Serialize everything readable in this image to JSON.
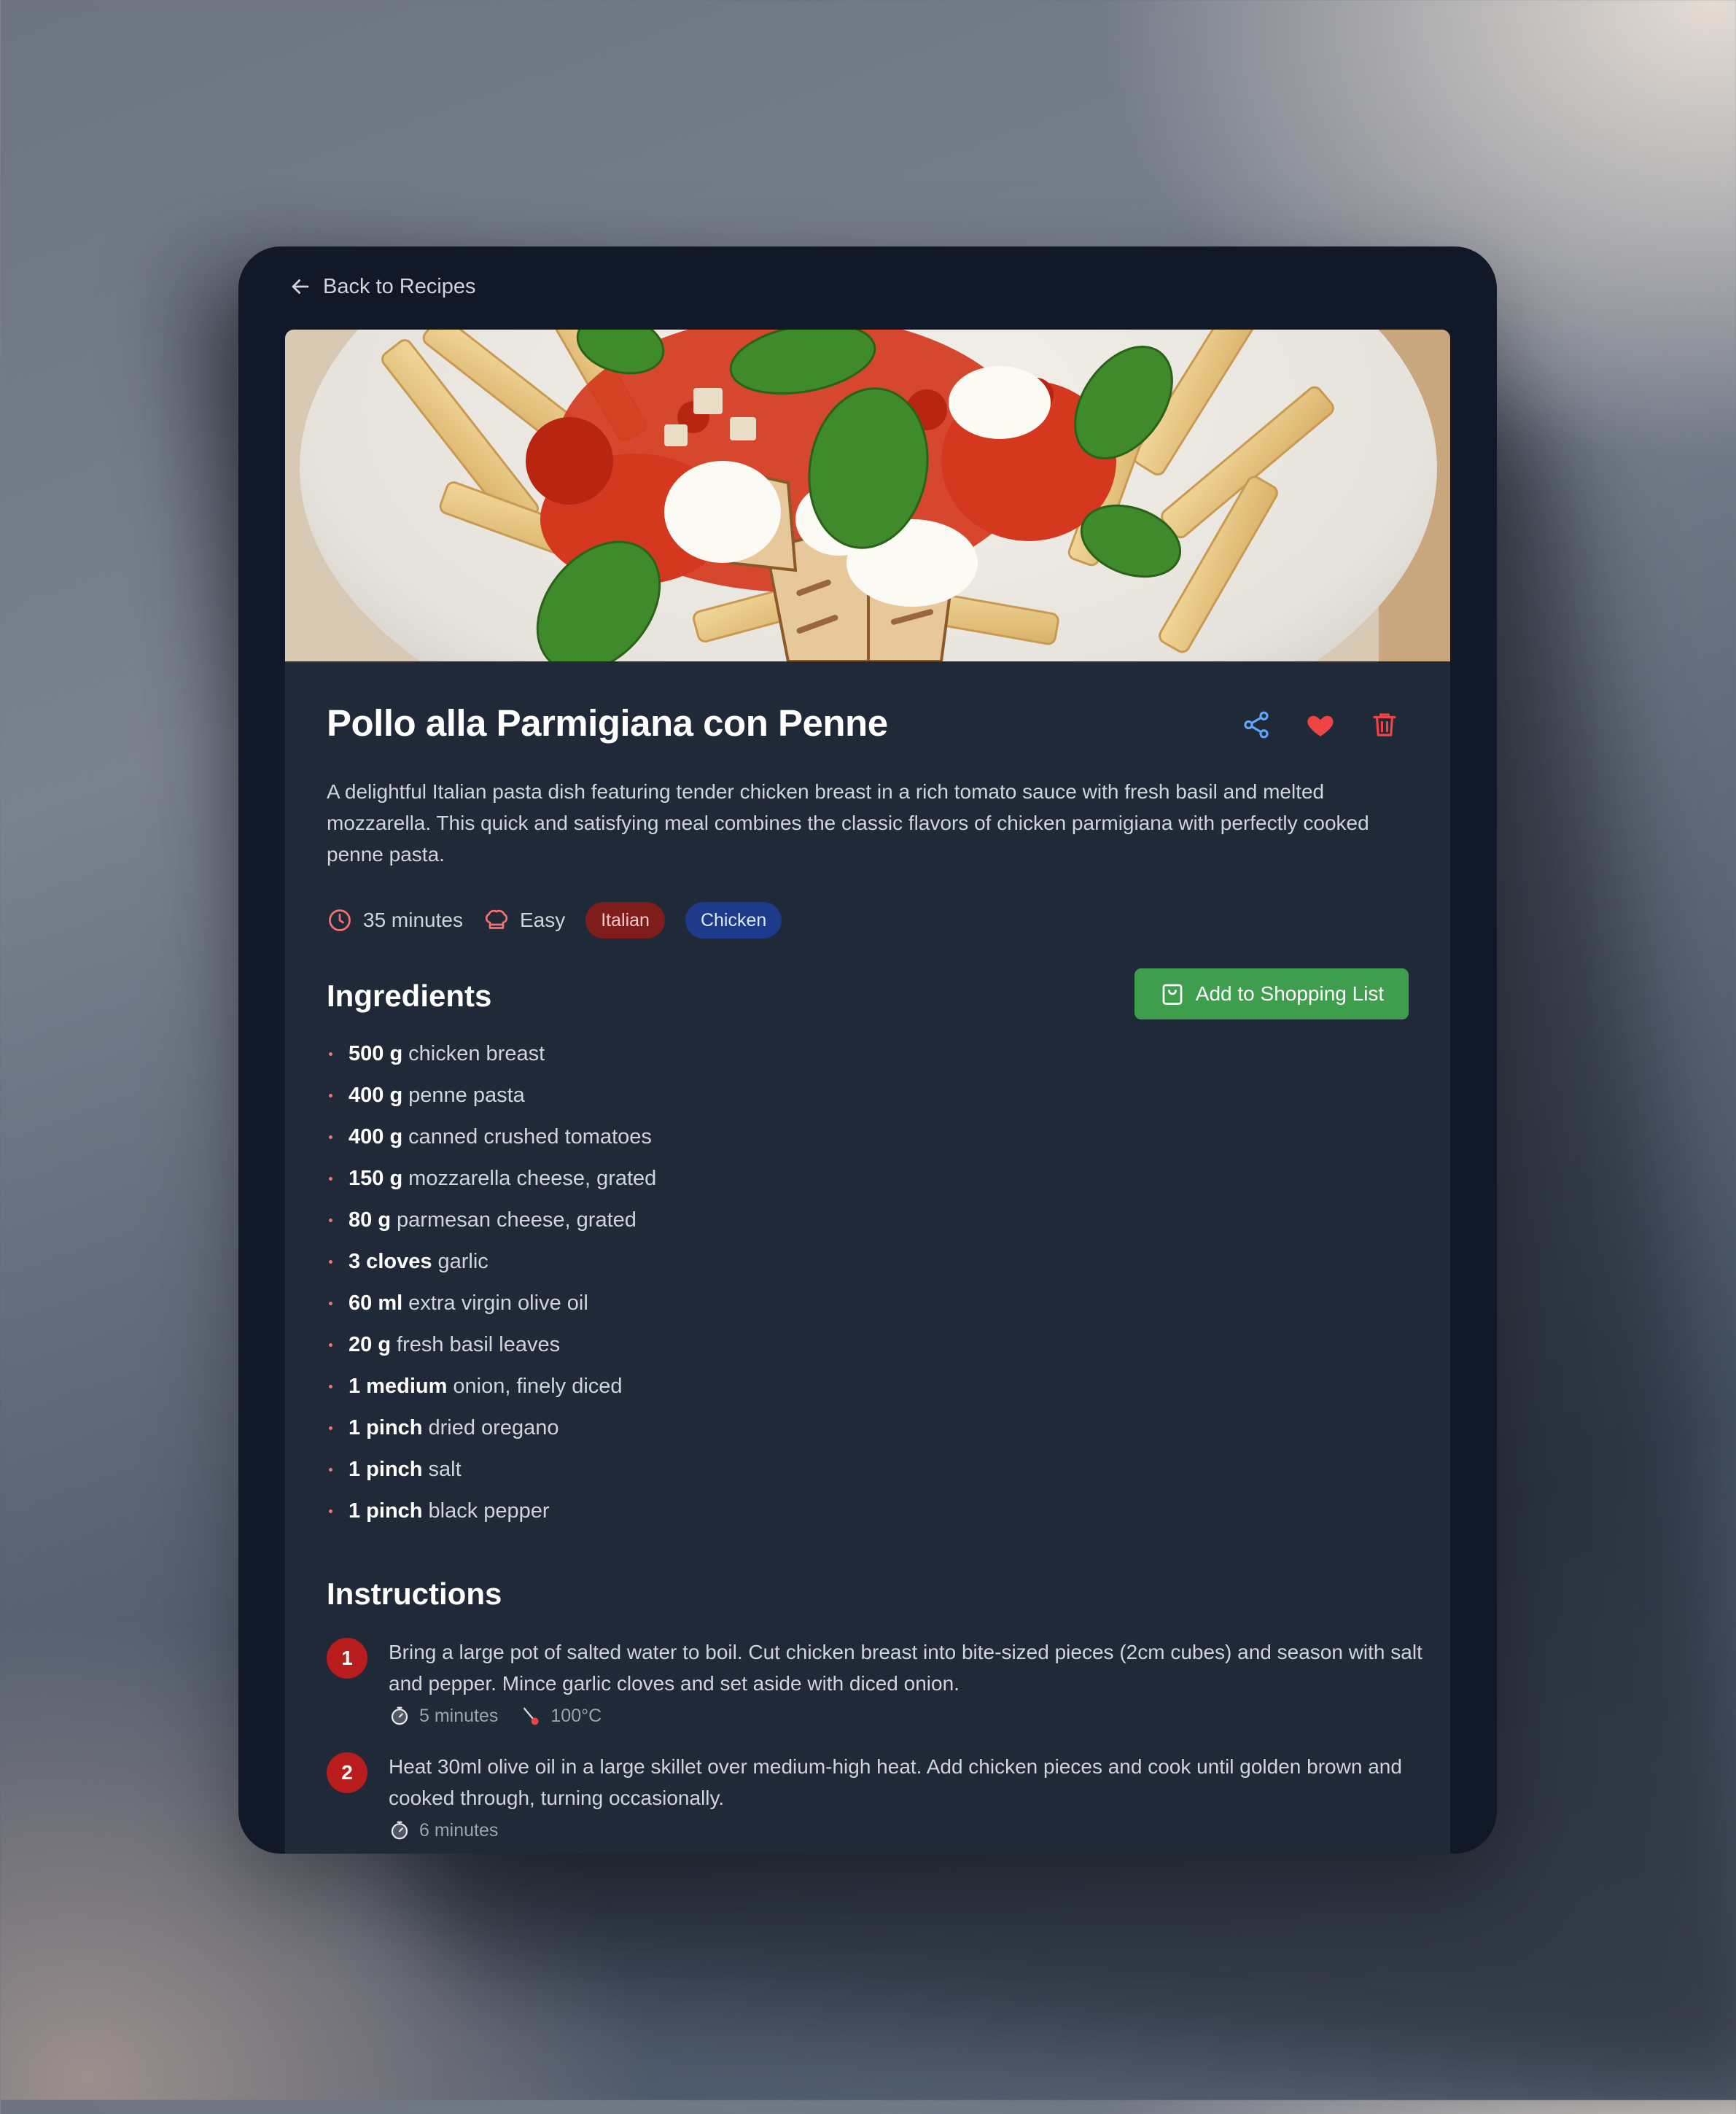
{
  "nav": {
    "back_label": "Back to Recipes"
  },
  "recipe": {
    "title": "Pollo alla Parmigiana con Penne",
    "description": "A delightful Italian pasta dish featuring tender chicken breast in a rich tomato sauce with fresh basil and melted mozzarella. This quick and satisfying meal combines the classic flavors of chicken parmigiana with perfectly cooked penne pasta.",
    "time": "35 minutes",
    "difficulty": "Easy",
    "tags": [
      "Italian",
      "Chicken"
    ]
  },
  "actions": {
    "icons": [
      "share-icon",
      "heart-icon",
      "trash-icon"
    ]
  },
  "ingredients": {
    "heading": "Ingredients",
    "shopping_button": "Add to Shopping List",
    "items": [
      {
        "qty": "500 g",
        "name": "chicken breast"
      },
      {
        "qty": "400 g",
        "name": "penne pasta"
      },
      {
        "qty": "400 g",
        "name": "canned crushed tomatoes"
      },
      {
        "qty": "150 g",
        "name": "mozzarella cheese, grated"
      },
      {
        "qty": "80 g",
        "name": "parmesan cheese, grated"
      },
      {
        "qty": "3 cloves",
        "name": "garlic"
      },
      {
        "qty": "60 ml",
        "name": "extra virgin olive oil"
      },
      {
        "qty": "20 g",
        "name": "fresh basil leaves"
      },
      {
        "qty": "1 medium",
        "name": "onion, finely diced"
      },
      {
        "qty": "1 pinch",
        "name": "dried oregano"
      },
      {
        "qty": "1 pinch",
        "name": "salt"
      },
      {
        "qty": "1 pinch",
        "name": "black pepper"
      }
    ]
  },
  "instructions": {
    "heading": "Instructions",
    "steps": [
      {
        "num": "1",
        "text": "Bring a large pot of salted water to boil. Cut chicken breast into bite-sized pieces (2cm cubes) and season with salt and pepper. Mince garlic cloves and set aside with diced onion.",
        "time": "5 minutes",
        "temp": "100°C"
      },
      {
        "num": "2",
        "text": "Heat 30ml olive oil in a large skillet over medium-high heat. Add chicken pieces and cook until golden brown and cooked through, turning occasionally.",
        "time": "6 minutes"
      }
    ]
  },
  "colors": {
    "accent_red": "#b91c1c",
    "button_green": "#3f9d4e",
    "share_blue": "#60a5fa",
    "panel": "#1f2937",
    "frame": "#111827"
  }
}
